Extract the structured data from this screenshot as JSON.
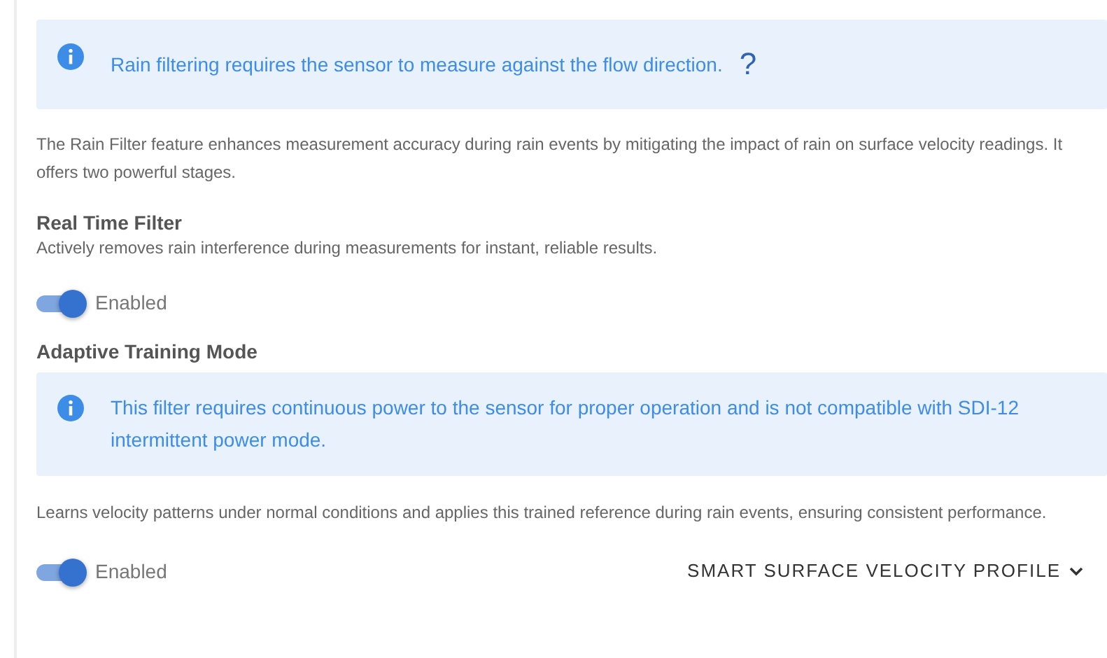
{
  "notice": {
    "text": "Rain filtering requires the sensor to measure against the flow direction.",
    "help": "?"
  },
  "intro": "The Rain Filter feature enhances measurement accuracy during rain events by mitigating the impact of rain on surface velocity readings. It offers two powerful stages.",
  "sections": [
    {
      "title": "Real Time Filter",
      "description": "Actively removes rain interference during measurements for instant, reliable results.",
      "toggle": {
        "on": true,
        "label": "Enabled"
      }
    },
    {
      "title": "Adaptive Training Mode",
      "notice": "This filter requires continuous power to the sensor for proper operation and is not compatible with SDI-12 intermittent power mode.",
      "description": "Learns velocity patterns under normal conditions and applies this trained reference during rain events, ensuring consistent performance.",
      "toggle": {
        "on": true,
        "label": "Enabled"
      },
      "link": "SMART SURFACE VELOCITY PROFILE"
    }
  ]
}
